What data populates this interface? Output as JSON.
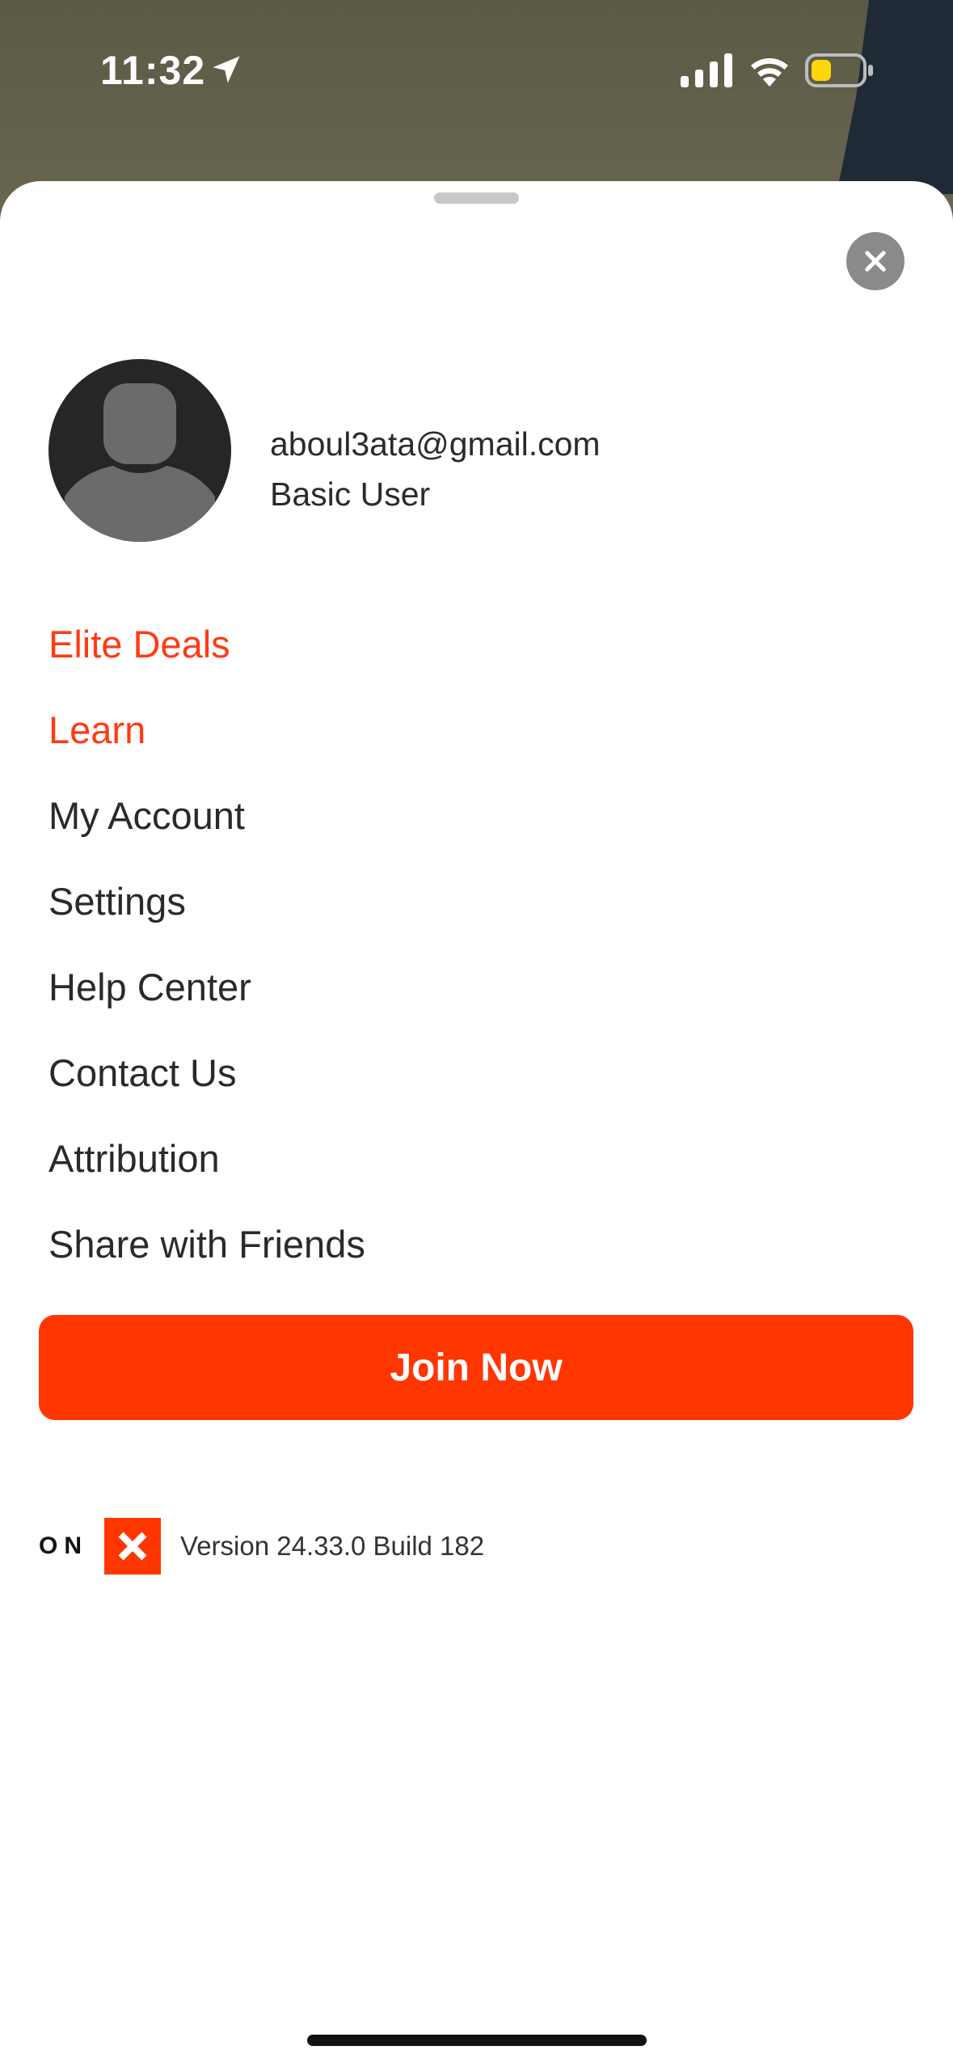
{
  "status_bar": {
    "time": "11:32",
    "icons": [
      "location-arrow-icon",
      "cellular-signal-icon",
      "wifi-icon",
      "battery-icon"
    ],
    "battery_color": "#ffd60a"
  },
  "profile": {
    "email": "aboul3ata@gmail.com",
    "tier": "Basic User"
  },
  "menu": {
    "items": [
      {
        "label": "Elite Deals",
        "accent": true
      },
      {
        "label": "Learn",
        "accent": true
      },
      {
        "label": "My Account",
        "accent": false
      },
      {
        "label": "Settings",
        "accent": false
      },
      {
        "label": "Help Center",
        "accent": false
      },
      {
        "label": "Contact Us",
        "accent": false
      },
      {
        "label": "Attribution",
        "accent": false
      },
      {
        "label": "Share with Friends",
        "accent": false
      }
    ]
  },
  "cta": {
    "join_label": "Join Now"
  },
  "footer": {
    "brand_on": "ON",
    "version": "Version 24.33.0 Build 182"
  },
  "colors": {
    "accent": "#ff3600",
    "menu_accent": "#ff3b14",
    "text": "#2a2a2a"
  }
}
